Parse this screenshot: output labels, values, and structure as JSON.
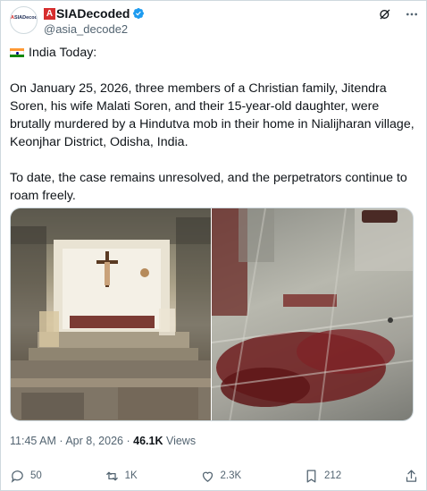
{
  "author": {
    "display_name": "SIADecoded",
    "display_name_initial": "A",
    "handle": "@asia_decode2",
    "avatar_text": "ASIADecoded",
    "avatar_text_a": "A",
    "verified": true
  },
  "post": {
    "source_line": "India Today:",
    "paragraph1": "On January 25, 2026, three members of a Christian family, Jitendra Soren, his wife Malati Soren, and their 15-year-old daughter, were brutally murdered by a Hindutva mob in their home in Nialijharan village, Keonjhar District, Odisha, India.",
    "paragraph2": "To date, the case remains unresolved, and the perpetrators continue to roam freely."
  },
  "meta": {
    "time": "11:45 AM",
    "separator": "·",
    "date": "Apr 8, 2026",
    "views_count": "46.1K",
    "views_label": "Views"
  },
  "actions": {
    "replies": "50",
    "reposts": "1K",
    "likes": "2.3K",
    "bookmarks": "212"
  },
  "colors": {
    "brand_red": "#d62e2e",
    "verified_blue": "#1d9bf0",
    "secondary_text": "#536471"
  }
}
